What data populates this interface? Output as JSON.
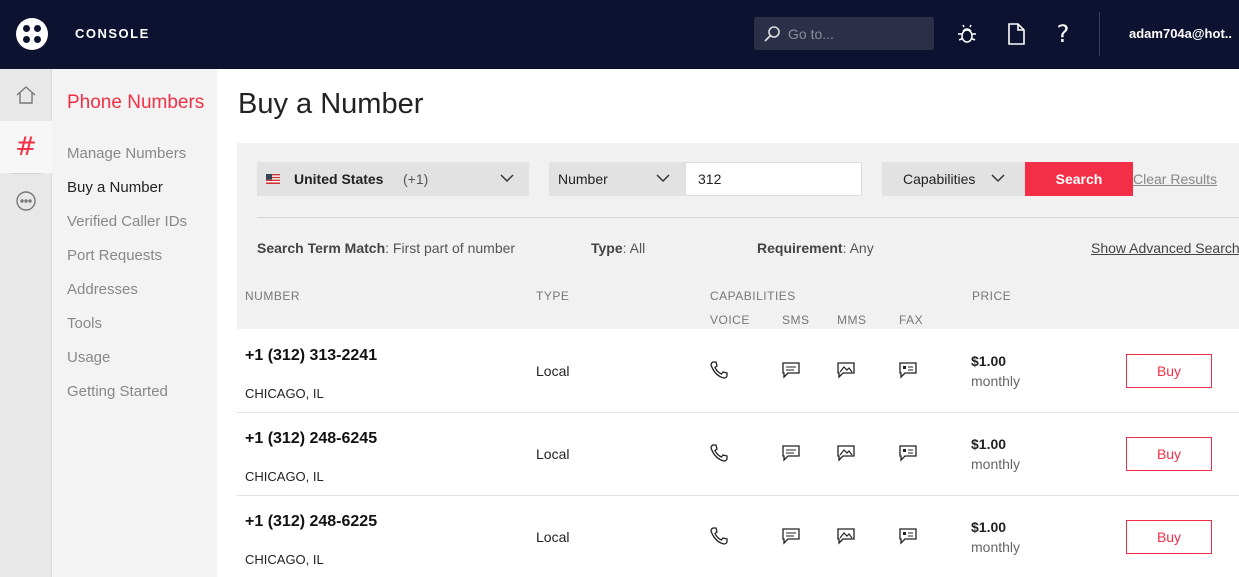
{
  "topbar": {
    "brand": "CONSOLE",
    "goto_placeholder": "Go to...",
    "user": "adam704a@hot.."
  },
  "sidenav": {
    "title": "Phone Numbers",
    "items": [
      {
        "label": "Manage Numbers"
      },
      {
        "label": "Buy a Number"
      },
      {
        "label": "Verified Caller IDs"
      },
      {
        "label": "Port Requests"
      },
      {
        "label": "Addresses"
      },
      {
        "label": "Tools"
      },
      {
        "label": "Usage"
      },
      {
        "label": "Getting Started"
      }
    ]
  },
  "page": {
    "title": "Buy a Number"
  },
  "search": {
    "country": "United States",
    "country_code": "(+1)",
    "number_type": "Number",
    "number_value": "312",
    "capabilities": "Capabilities",
    "search_label": "Search",
    "clear_label": "Clear Results",
    "filters": {
      "term_label": "Search Term Match",
      "term_value": ": First part of number",
      "type_label": "Type",
      "type_value": ": All",
      "req_label": "Requirement",
      "req_value": ": Any"
    },
    "advanced_label": "Show Advanced Search"
  },
  "table": {
    "headers": {
      "number": "NUMBER",
      "type": "TYPE",
      "capabilities": "CAPABILITIES",
      "price": "PRICE",
      "voice": "VOICE",
      "sms": "SMS",
      "mms": "MMS",
      "fax": "FAX"
    },
    "rows": [
      {
        "number": "+1  (312) 313-2241",
        "city": "CHICAGO, IL",
        "type": "Local",
        "price": "$1.00",
        "period": "monthly",
        "buy": "Buy"
      },
      {
        "number": "+1  (312) 248-6245",
        "city": "CHICAGO, IL",
        "type": "Local",
        "price": "$1.00",
        "period": "monthly",
        "buy": "Buy"
      },
      {
        "number": "+1  (312) 248-6225",
        "city": "CHICAGO, IL",
        "type": "Local",
        "price": "$1.00",
        "period": "monthly",
        "buy": "Buy"
      }
    ]
  },
  "colors": {
    "topbar_bg": "#0d1230",
    "accent": "#f22f46"
  },
  "icons": {
    "logo": "twilio-logo-icon",
    "search": "search-icon",
    "debugger": "bug-icon",
    "docs": "document-icon",
    "help": "question-icon",
    "home": "home-icon",
    "hash": "hash-icon",
    "more": "ellipsis-icon",
    "voice": "phone-icon",
    "sms": "message-icon",
    "mms": "image-message-icon",
    "fax": "fax-icon"
  }
}
